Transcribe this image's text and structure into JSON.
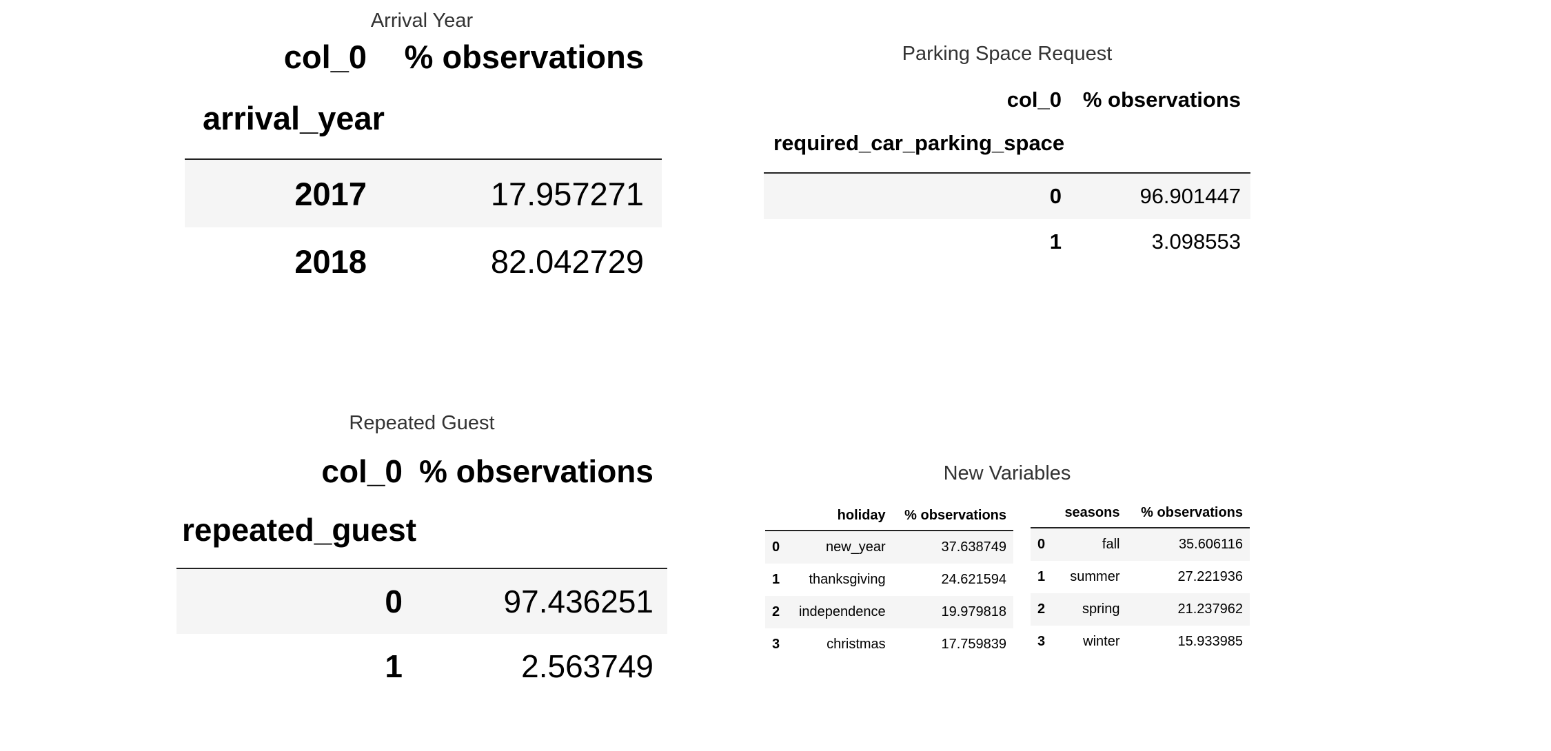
{
  "arrival_year": {
    "title": "Arrival Year",
    "col_header": "col_0",
    "value_header": "% observations",
    "index_name": "arrival_year",
    "rows": [
      {
        "index": "2017",
        "value": "17.957271"
      },
      {
        "index": "2018",
        "value": "82.042729"
      }
    ]
  },
  "parking": {
    "title": "Parking Space Request",
    "col_header": "col_0",
    "value_header": "% observations",
    "index_name": "required_car_parking_space",
    "rows": [
      {
        "index": "0",
        "value": "96.901447"
      },
      {
        "index": "1",
        "value": "3.098553"
      }
    ]
  },
  "repeated_guest": {
    "title": "Repeated Guest",
    "col_header": "col_0",
    "value_header": "% observations",
    "index_name": "repeated_guest",
    "rows": [
      {
        "index": "0",
        "value": "97.436251"
      },
      {
        "index": "1",
        "value": "2.563749"
      }
    ]
  },
  "new_variables": {
    "title": "New Variables",
    "holiday": {
      "headers": [
        "",
        "holiday",
        "% observations"
      ],
      "rows": [
        {
          "index": "0",
          "name": "new_year",
          "value": "37.638749"
        },
        {
          "index": "1",
          "name": "thanksgiving",
          "value": "24.621594"
        },
        {
          "index": "2",
          "name": "independence",
          "value": "19.979818"
        },
        {
          "index": "3",
          "name": "christmas",
          "value": "17.759839"
        }
      ]
    },
    "seasons": {
      "headers": [
        "",
        "seasons",
        "% observations"
      ],
      "rows": [
        {
          "index": "0",
          "name": "fall",
          "value": "35.606116"
        },
        {
          "index": "1",
          "name": "summer",
          "value": "27.221936"
        },
        {
          "index": "2",
          "name": "spring",
          "value": "21.237962"
        },
        {
          "index": "3",
          "name": "winter",
          "value": "15.933985"
        }
      ]
    }
  }
}
